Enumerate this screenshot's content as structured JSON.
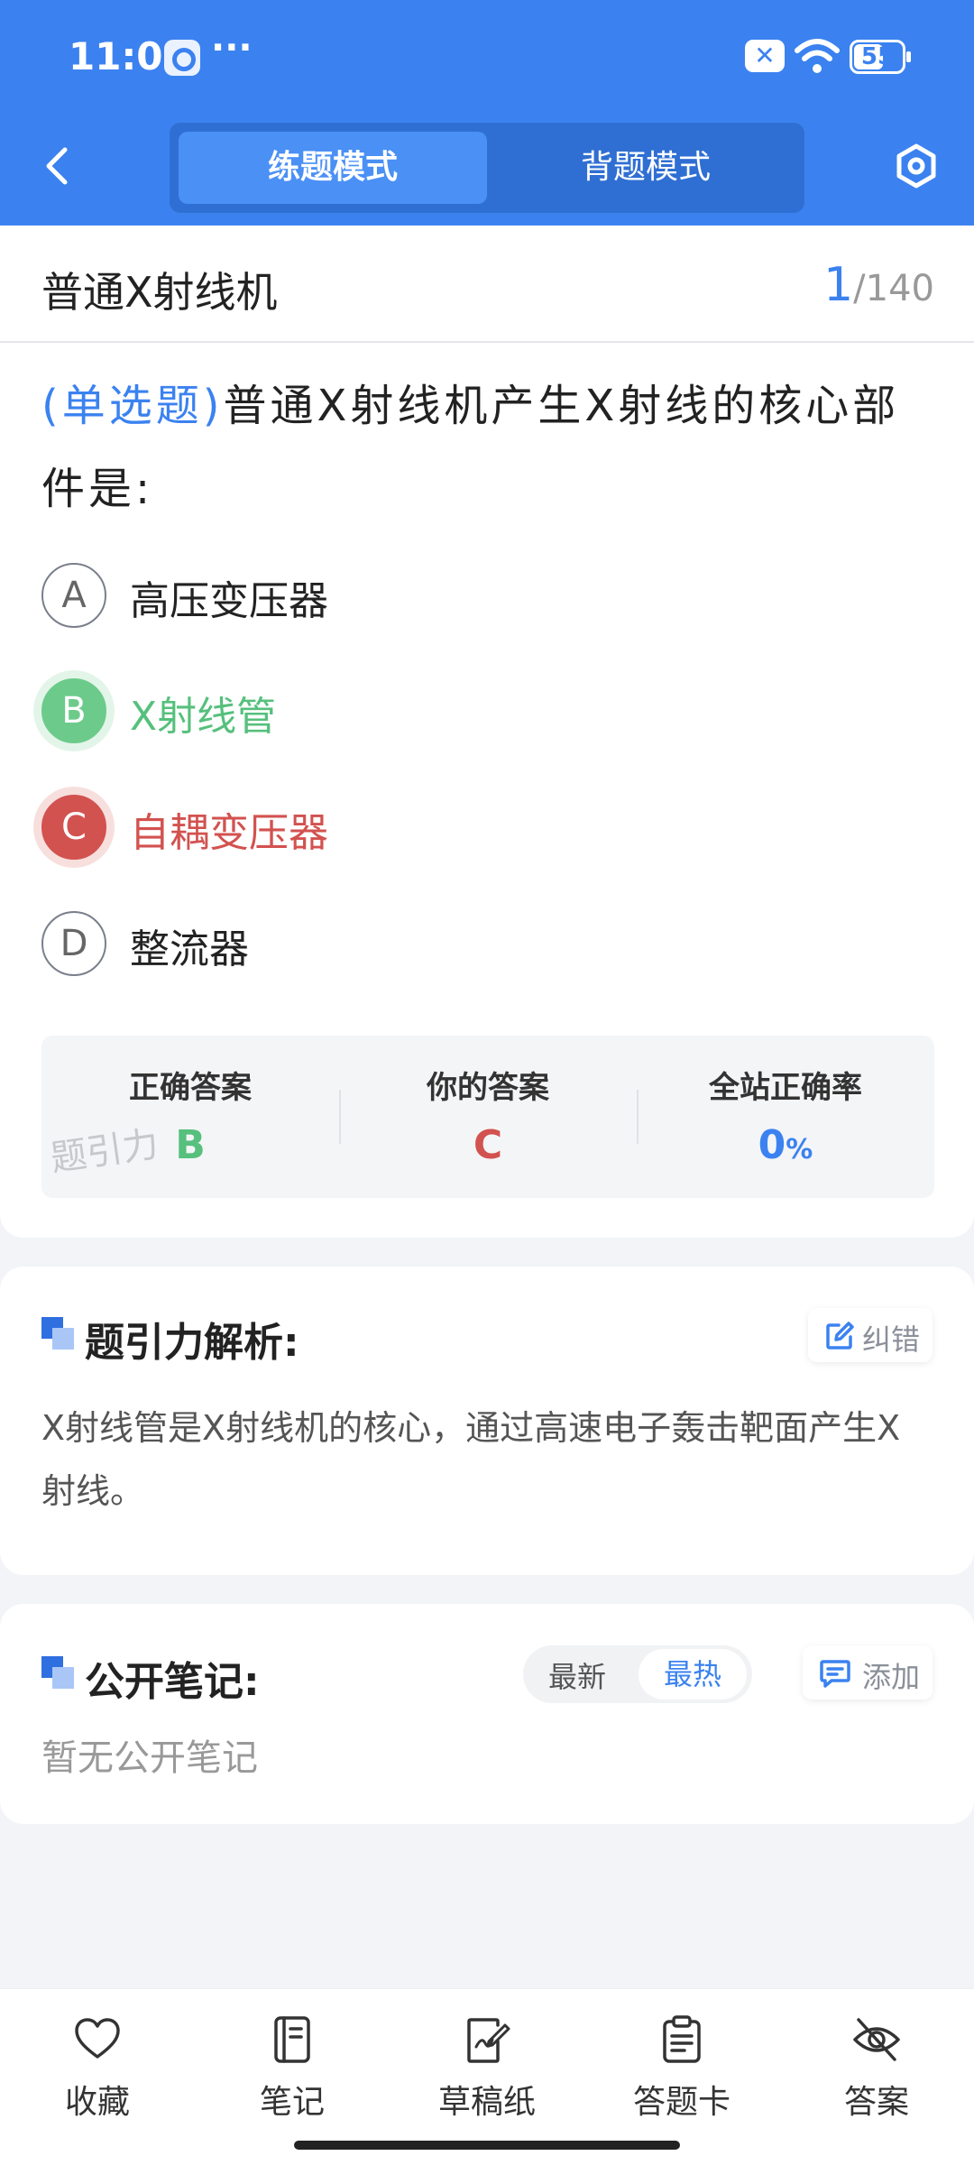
{
  "status": {
    "time": "11:01",
    "dots": "···",
    "battery": "55"
  },
  "header": {
    "tab_active": "练题模式",
    "tab_other": "背题模式"
  },
  "question": {
    "title": "普通X射线机",
    "current": "1",
    "total": "/140",
    "type_tag": "(单选题)",
    "text": "普通X射线机产生X射线的核心部件是:",
    "options": [
      {
        "letter": "A",
        "text": "高压变压器",
        "state": "normal"
      },
      {
        "letter": "B",
        "text": "X射线管",
        "state": "correct"
      },
      {
        "letter": "C",
        "text": "自耦变压器",
        "state": "wrong"
      },
      {
        "letter": "D",
        "text": "整流器",
        "state": "normal"
      }
    ],
    "answer_summary": {
      "correct_label": "正确答案",
      "correct_value": "B",
      "yours_label": "你的答案",
      "yours_value": "C",
      "rate_label": "全站正确率",
      "rate_value": "0",
      "rate_unit": "%",
      "watermark": "题引力"
    }
  },
  "analysis": {
    "title": "题引力解析:",
    "fix_label": "纠错",
    "text": "X射线管是X射线机的核心，通过高速电子轰击靶面产生X射线。"
  },
  "notes": {
    "title": "公开笔记:",
    "sort_new": "最新",
    "sort_hot": "最热",
    "add_label": "添加",
    "empty_text": "暂无公开笔记"
  },
  "tabbar": {
    "items": [
      {
        "label": "收藏",
        "icon": "heart-icon"
      },
      {
        "label": "笔记",
        "icon": "notebook-icon"
      },
      {
        "label": "草稿纸",
        "icon": "draft-paper-icon"
      },
      {
        "label": "答题卡",
        "icon": "answer-sheet-icon"
      },
      {
        "label": "答案",
        "icon": "eye-off-icon"
      }
    ]
  },
  "colors": {
    "primary": "#3b82f0",
    "correct": "#56c07c",
    "wrong": "#d2524f"
  }
}
